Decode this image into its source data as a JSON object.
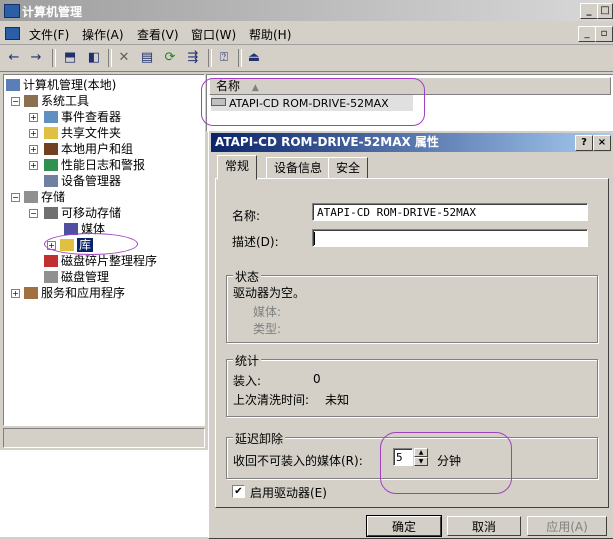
{
  "window": {
    "title": "计算机管理"
  },
  "menu": [
    "文件(F)",
    "操作(A)",
    "查看(V)",
    "窗口(W)",
    "帮助(H)"
  ],
  "tree": {
    "root": "计算机管理(本地)",
    "system_tools": "系统工具",
    "event_viewer": "事件查看器",
    "shared_folders": "共享文件夹",
    "local_users": "本地用户和组",
    "perf_logs": "性能日志和警报",
    "device_manager": "设备管理器",
    "storage": "存储",
    "removable_storage": "可移动存储",
    "media": "媒体",
    "library": "库",
    "defrag": "磁盘碎片整理程序",
    "disk_mgmt": "磁盘管理",
    "services": "服务和应用程序"
  },
  "list": {
    "col_name": "名称",
    "item": "ATAPI-CD ROM-DRIVE-52MAX"
  },
  "dialog": {
    "title": "ATAPI-CD ROM-DRIVE-52MAX 属性",
    "help_btn": "?",
    "close_btn": "×",
    "tabs": [
      "常规",
      "设备信息",
      "安全"
    ],
    "name_label": "名称:",
    "name_value": "ATAPI-CD ROM-DRIVE-52MAX",
    "desc_label": "描述(D):",
    "desc_value": "",
    "status_group": "状态",
    "status_text": "驱动器为空。",
    "media_label": "媒体:",
    "type_label": "类型:",
    "stats_group": "统计",
    "mounts_label": "装入:",
    "mounts_value": "0",
    "last_clean_label": "上次清洗时间:",
    "last_clean_value": "未知",
    "eject_group": "延迟卸除",
    "eject_label": "收回不可装入的媒体(R):",
    "eject_value": "5",
    "eject_unit": "分钟",
    "enable_label": "启用驱动器(E)",
    "enable_checked": true,
    "ok": "确定",
    "cancel": "取消",
    "apply": "应用(A)"
  }
}
